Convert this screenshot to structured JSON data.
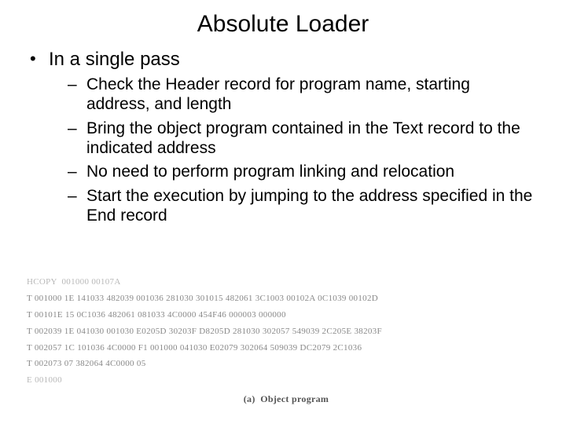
{
  "title": "Absolute Loader",
  "bullets": {
    "level1": "In a single pass",
    "level2": [
      "Check the Header record for program name, starting address, and length",
      "Bring the object program contained in the Text record to the indicated address",
      "No need to perform program linking and relocation",
      "Start the execution by jumping to the address specified in the End record"
    ]
  },
  "object_program": {
    "lines": [
      "HCOPY  001000 00107A",
      "T 001000 1E 141033 482039 001036 281030 301015 482061 3C1003 00102A 0C1039 00102D",
      "T 00101E 15 0C1036 482061 081033 4C0000 454F46 000003 000000",
      "T 002039 1E 041030 001030 E0205D 30203F D8205D 281030 302057 549039 2C205E 38203F",
      "T 002057 1C 101036 4C0000 F1 001000 041030 E02079 302064 509039 DC2079 2C1036",
      "T 002073 07 382064 4C0000 05",
      "E 001000"
    ],
    "caption_label": "(a)",
    "caption_text": "Object program"
  }
}
